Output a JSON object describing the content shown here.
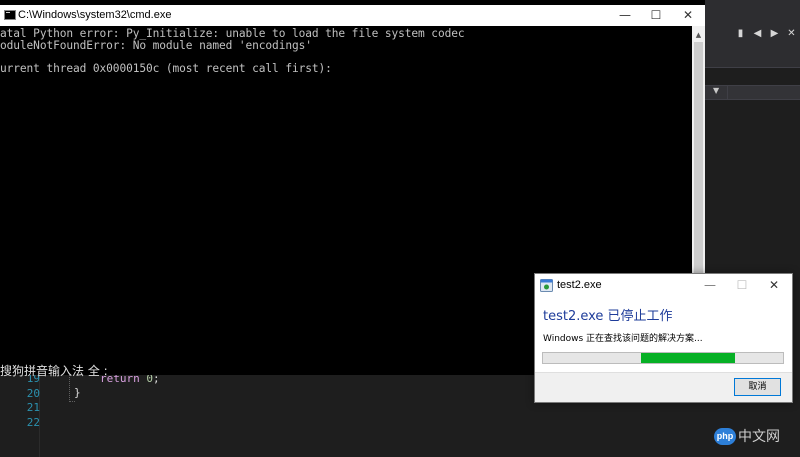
{
  "cmd": {
    "title": "C:\\Windows\\system32\\cmd.exe",
    "lines": [
      "atal Python error: Py_Initialize: unable to load the file system codec",
      "oduleNotFoundError: No module named 'encodings'",
      "",
      "urrent thread 0x0000150c (most recent call first):"
    ],
    "ime_status": "搜狗拼音输入法 全 :",
    "controls": {
      "minimize": "—",
      "maximize": "☐",
      "close": "✕"
    }
  },
  "editor": {
    "line_numbers": [
      "19",
      "20",
      "21",
      "22"
    ],
    "code": {
      "keyword": "return",
      "value": "0",
      "semicolon": ";",
      "brace": "}"
    }
  },
  "dialog": {
    "title": "test2.exe",
    "heading": "test2.exe 已停止工作",
    "message": "Windows 正在查找该问题的解决方案...",
    "progress": {
      "start_fraction": 0.41,
      "end_fraction": 0.8
    },
    "cancel_label": "取消",
    "controls": {
      "minimize": "—",
      "maximize": "☐",
      "close": "✕"
    }
  },
  "watermark": {
    "badge": "php",
    "text": "中文网"
  },
  "colors": {
    "dialog_heading": "#1e3c9a",
    "progress_fill": "#06b025",
    "ide_background": "#1e1e1e",
    "console_background": "#000000"
  },
  "icons": [
    "cmd-app-icon",
    "app-error-icon",
    "bookmark-icon",
    "bookmark-prev-icon",
    "bookmark-next-icon",
    "bookmark-clear-icon",
    "dropdown-arrow-icon"
  ]
}
